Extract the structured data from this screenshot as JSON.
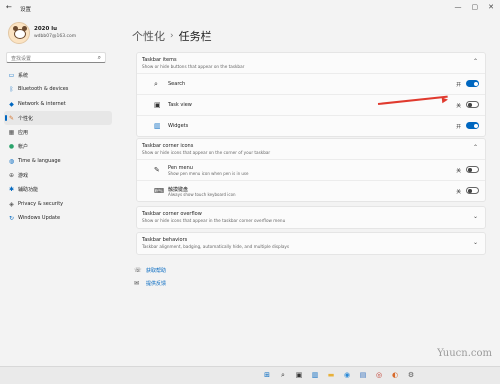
{
  "titlebar": {
    "back": "←",
    "title": "设置",
    "controls": [
      "—",
      "▢",
      "✕"
    ]
  },
  "profile": {
    "name": "2020 lu",
    "email": "wdbb07@163.com"
  },
  "search": {
    "placeholder": "查找设置",
    "icon": "search-icon"
  },
  "nav": [
    {
      "label": "系统",
      "icon": "display-icon",
      "color": "#0067c0"
    },
    {
      "label": "Bluetooth & devices",
      "icon": "bluetooth-icon",
      "color": "#0067c0"
    },
    {
      "label": "Network & internet",
      "icon": "wifi-icon",
      "color": "#0067c0"
    },
    {
      "label": "个性化",
      "icon": "brush-icon",
      "color": "#d4722a",
      "active": true
    },
    {
      "label": "应用",
      "icon": "apps-icon",
      "color": "#555555"
    },
    {
      "label": "帐户",
      "icon": "person-icon",
      "color": "#2aa36b"
    },
    {
      "label": "Time & language",
      "icon": "globe-icon",
      "color": "#0067c0"
    },
    {
      "label": "游戏",
      "icon": "gamepad-icon",
      "color": "#555555"
    },
    {
      "label": "辅助功能",
      "icon": "accessibility-icon",
      "color": "#0067c0"
    },
    {
      "label": "Privacy & security",
      "icon": "shield-icon",
      "color": "#555555"
    },
    {
      "label": "Windows Update",
      "icon": "update-icon",
      "color": "#0067c0"
    }
  ],
  "breadcrumb": {
    "parent": "个性化",
    "separator": "›",
    "current": "任务栏"
  },
  "sections": {
    "taskbar_items": {
      "title": "Taskbar items",
      "subtitle": "Show or hide buttons that appear on the taskbar",
      "rows": [
        {
          "label": "Search",
          "icon": "search-icon",
          "state": "开",
          "on": true
        },
        {
          "label": "Task view",
          "icon": "task-view-icon",
          "state": "关",
          "on": false
        },
        {
          "label": "Widgets",
          "icon": "widgets-icon",
          "state": "开",
          "on": true
        }
      ]
    },
    "corner_icons": {
      "title": "Taskbar corner icons",
      "subtitle": "Show or hide icons that appear on the corner of your taskbar",
      "rows": [
        {
          "label": "Pen menu",
          "desc": "Show pen menu icon when pen is in use",
          "icon": "pen-icon",
          "state": "关",
          "on": false
        },
        {
          "label": "触摸键盘",
          "desc": "Always show touch keyboard icon",
          "icon": "keyboard-icon",
          "state": "关",
          "on": false
        }
      ]
    },
    "corner_overflow": {
      "title": "Taskbar corner overflow",
      "subtitle": "Show or hide icons that appear in the taskbar corner overflow menu"
    },
    "behaviors": {
      "title": "Taskbar behaviors",
      "subtitle": "Taskbar alignment, badging, automatically hide, and multiple displays"
    }
  },
  "links": [
    {
      "label": "获取帮助",
      "icon": "help-icon"
    },
    {
      "label": "提供反馈",
      "icon": "feedback-icon"
    }
  ],
  "watermark": "Yuucn.com",
  "colors": {
    "accent": "#0067c0",
    "annotation_arrow": "#e03a2e"
  }
}
